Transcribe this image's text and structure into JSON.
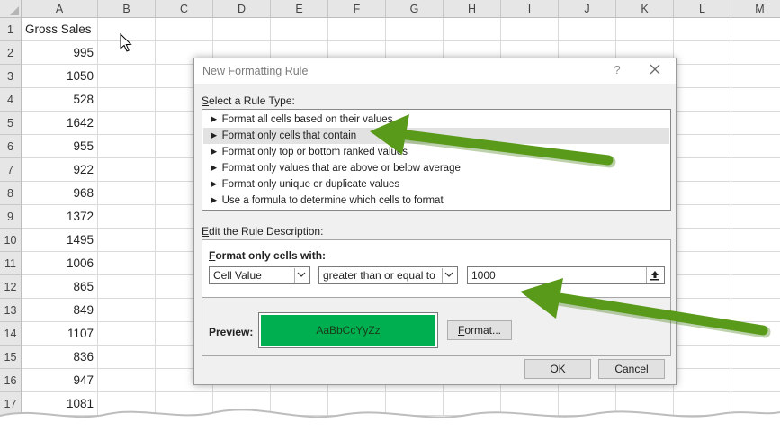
{
  "spreadsheet": {
    "columns": [
      "A",
      "B",
      "C",
      "D",
      "E",
      "F",
      "G",
      "H",
      "I",
      "J",
      "K",
      "L",
      "M"
    ],
    "rows": [
      {
        "num": "1",
        "a": "Gross Sales"
      },
      {
        "num": "2",
        "a": "995"
      },
      {
        "num": "3",
        "a": "1050"
      },
      {
        "num": "4",
        "a": "528"
      },
      {
        "num": "5",
        "a": "1642"
      },
      {
        "num": "6",
        "a": "955"
      },
      {
        "num": "7",
        "a": "922"
      },
      {
        "num": "8",
        "a": "968"
      },
      {
        "num": "9",
        "a": "1372"
      },
      {
        "num": "10",
        "a": "1495"
      },
      {
        "num": "11",
        "a": "1006"
      },
      {
        "num": "12",
        "a": "865"
      },
      {
        "num": "13",
        "a": "849"
      },
      {
        "num": "14",
        "a": "1107"
      },
      {
        "num": "15",
        "a": "836"
      },
      {
        "num": "16",
        "a": "947"
      },
      {
        "num": "17",
        "a": "1081"
      }
    ]
  },
  "dialog": {
    "title": "New Formatting Rule",
    "help_label": "?",
    "select_rule_type": {
      "key": "S",
      "rest": "elect a Rule Type:"
    },
    "rule_types": [
      {
        "label": "► Format all cells based on their values"
      },
      {
        "label": "► Format only cells that contain"
      },
      {
        "label": "► Format only top or bottom ranked values"
      },
      {
        "label": "► Format only values that are above or below average"
      },
      {
        "label": "► Format only unique or duplicate values"
      },
      {
        "label": "► Use a formula to determine which cells to format"
      }
    ],
    "selected_rule_index": 1,
    "edit_description": {
      "key": "E",
      "rest": "dit the Rule Description:"
    },
    "format_only_cells_with": {
      "key": "F",
      "rest": "ormat only cells with:"
    },
    "condition_type": "Cell Value",
    "operator": "greater than or equal to",
    "value": "1000",
    "preview_label": "Preview:",
    "preview_text": "AaBbCcYyZz",
    "preview_color": "#00b050",
    "format_button": {
      "key": "F",
      "rest": "ormat..."
    },
    "ok_label": "OK",
    "cancel_label": "Cancel"
  },
  "annotations": {
    "arrow_color": "#5a9a1a"
  }
}
